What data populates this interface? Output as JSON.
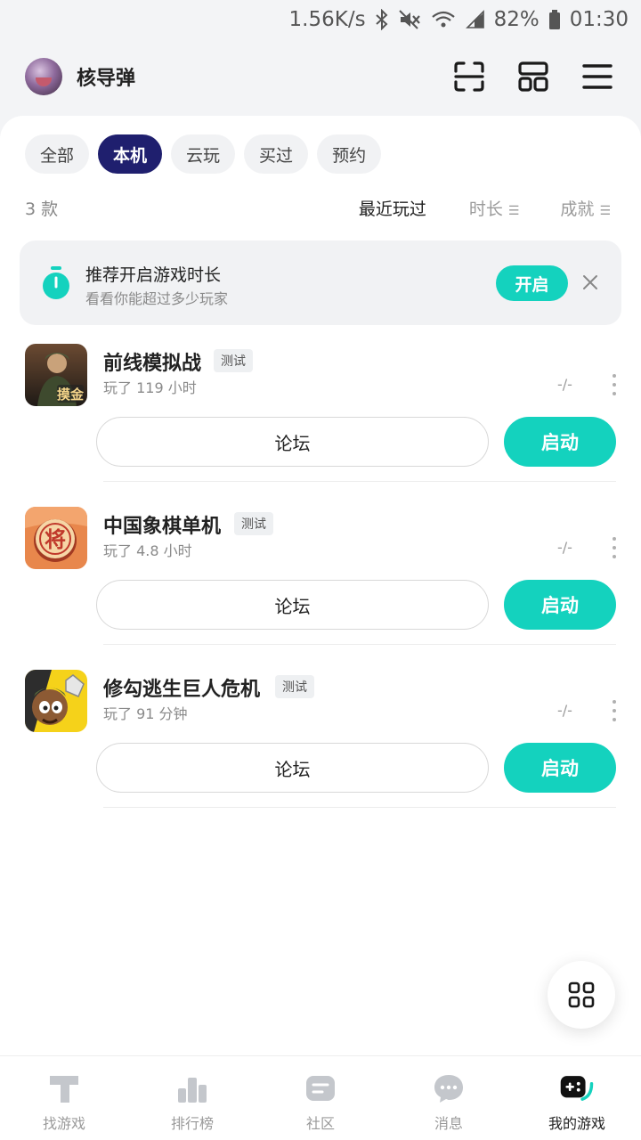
{
  "status_bar": {
    "speed": "1.56K/s",
    "battery": "82%",
    "time": "01:30"
  },
  "header": {
    "username": "核导弹"
  },
  "filters": [
    "全部",
    "本机",
    "云玩",
    "买过",
    "预约"
  ],
  "active_filter_index": 1,
  "list_info": {
    "count": "3 款",
    "sorts": [
      "最近玩过",
      "时长",
      "成就"
    ]
  },
  "banner": {
    "title": "推荐开启游戏时长",
    "subtitle": "看看你能超过多少玩家",
    "button": "开启"
  },
  "games": [
    {
      "name": "前线模拟战",
      "tag": "测试",
      "played": "玩了 119 小时",
      "achievement": "-/-",
      "icon_text": "摸金",
      "forum": "论坛",
      "launch": "启动"
    },
    {
      "name": "中国象棋单机",
      "tag": "测试",
      "played": "玩了 4.8 小时",
      "achievement": "-/-",
      "icon_text": "将",
      "forum": "论坛",
      "launch": "启动"
    },
    {
      "name": "修勾逃生巨人危机",
      "tag": "测试",
      "played": "玩了 91 分钟",
      "achievement": "-/-",
      "forum": "论坛",
      "launch": "启动"
    }
  ],
  "tabbar": [
    {
      "label": "找游戏",
      "icon": "find-games-icon"
    },
    {
      "label": "排行榜",
      "icon": "ranking-icon"
    },
    {
      "label": "社区",
      "icon": "community-icon"
    },
    {
      "label": "消息",
      "icon": "message-icon"
    },
    {
      "label": "我的游戏",
      "icon": "my-games-icon"
    }
  ],
  "colors": {
    "accent": "#14d2be",
    "chip_active": "#1f1f6e"
  }
}
